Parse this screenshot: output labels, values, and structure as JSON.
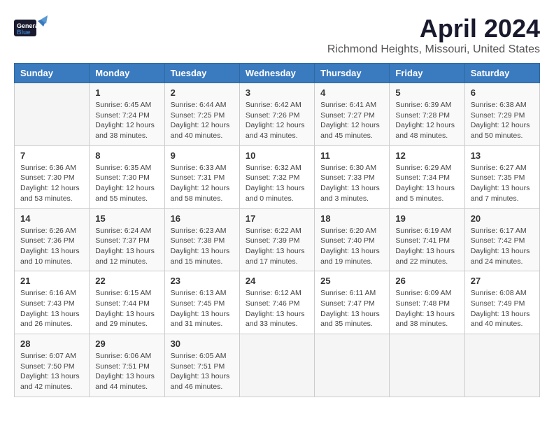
{
  "header": {
    "logo_general": "General",
    "logo_blue": "Blue",
    "month": "April 2024",
    "location": "Richmond Heights, Missouri, United States"
  },
  "days_of_week": [
    "Sunday",
    "Monday",
    "Tuesday",
    "Wednesday",
    "Thursday",
    "Friday",
    "Saturday"
  ],
  "weeks": [
    [
      {
        "day": "",
        "sunrise": "",
        "sunset": "",
        "daylight": ""
      },
      {
        "day": "1",
        "sunrise": "Sunrise: 6:45 AM",
        "sunset": "Sunset: 7:24 PM",
        "daylight": "Daylight: 12 hours and 38 minutes."
      },
      {
        "day": "2",
        "sunrise": "Sunrise: 6:44 AM",
        "sunset": "Sunset: 7:25 PM",
        "daylight": "Daylight: 12 hours and 40 minutes."
      },
      {
        "day": "3",
        "sunrise": "Sunrise: 6:42 AM",
        "sunset": "Sunset: 7:26 PM",
        "daylight": "Daylight: 12 hours and 43 minutes."
      },
      {
        "day": "4",
        "sunrise": "Sunrise: 6:41 AM",
        "sunset": "Sunset: 7:27 PM",
        "daylight": "Daylight: 12 hours and 45 minutes."
      },
      {
        "day": "5",
        "sunrise": "Sunrise: 6:39 AM",
        "sunset": "Sunset: 7:28 PM",
        "daylight": "Daylight: 12 hours and 48 minutes."
      },
      {
        "day": "6",
        "sunrise": "Sunrise: 6:38 AM",
        "sunset": "Sunset: 7:29 PM",
        "daylight": "Daylight: 12 hours and 50 minutes."
      }
    ],
    [
      {
        "day": "7",
        "sunrise": "Sunrise: 6:36 AM",
        "sunset": "Sunset: 7:30 PM",
        "daylight": "Daylight: 12 hours and 53 minutes."
      },
      {
        "day": "8",
        "sunrise": "Sunrise: 6:35 AM",
        "sunset": "Sunset: 7:30 PM",
        "daylight": "Daylight: 12 hours and 55 minutes."
      },
      {
        "day": "9",
        "sunrise": "Sunrise: 6:33 AM",
        "sunset": "Sunset: 7:31 PM",
        "daylight": "Daylight: 12 hours and 58 minutes."
      },
      {
        "day": "10",
        "sunrise": "Sunrise: 6:32 AM",
        "sunset": "Sunset: 7:32 PM",
        "daylight": "Daylight: 13 hours and 0 minutes."
      },
      {
        "day": "11",
        "sunrise": "Sunrise: 6:30 AM",
        "sunset": "Sunset: 7:33 PM",
        "daylight": "Daylight: 13 hours and 3 minutes."
      },
      {
        "day": "12",
        "sunrise": "Sunrise: 6:29 AM",
        "sunset": "Sunset: 7:34 PM",
        "daylight": "Daylight: 13 hours and 5 minutes."
      },
      {
        "day": "13",
        "sunrise": "Sunrise: 6:27 AM",
        "sunset": "Sunset: 7:35 PM",
        "daylight": "Daylight: 13 hours and 7 minutes."
      }
    ],
    [
      {
        "day": "14",
        "sunrise": "Sunrise: 6:26 AM",
        "sunset": "Sunset: 7:36 PM",
        "daylight": "Daylight: 13 hours and 10 minutes."
      },
      {
        "day": "15",
        "sunrise": "Sunrise: 6:24 AM",
        "sunset": "Sunset: 7:37 PM",
        "daylight": "Daylight: 13 hours and 12 minutes."
      },
      {
        "day": "16",
        "sunrise": "Sunrise: 6:23 AM",
        "sunset": "Sunset: 7:38 PM",
        "daylight": "Daylight: 13 hours and 15 minutes."
      },
      {
        "day": "17",
        "sunrise": "Sunrise: 6:22 AM",
        "sunset": "Sunset: 7:39 PM",
        "daylight": "Daylight: 13 hours and 17 minutes."
      },
      {
        "day": "18",
        "sunrise": "Sunrise: 6:20 AM",
        "sunset": "Sunset: 7:40 PM",
        "daylight": "Daylight: 13 hours and 19 minutes."
      },
      {
        "day": "19",
        "sunrise": "Sunrise: 6:19 AM",
        "sunset": "Sunset: 7:41 PM",
        "daylight": "Daylight: 13 hours and 22 minutes."
      },
      {
        "day": "20",
        "sunrise": "Sunrise: 6:17 AM",
        "sunset": "Sunset: 7:42 PM",
        "daylight": "Daylight: 13 hours and 24 minutes."
      }
    ],
    [
      {
        "day": "21",
        "sunrise": "Sunrise: 6:16 AM",
        "sunset": "Sunset: 7:43 PM",
        "daylight": "Daylight: 13 hours and 26 minutes."
      },
      {
        "day": "22",
        "sunrise": "Sunrise: 6:15 AM",
        "sunset": "Sunset: 7:44 PM",
        "daylight": "Daylight: 13 hours and 29 minutes."
      },
      {
        "day": "23",
        "sunrise": "Sunrise: 6:13 AM",
        "sunset": "Sunset: 7:45 PM",
        "daylight": "Daylight: 13 hours and 31 minutes."
      },
      {
        "day": "24",
        "sunrise": "Sunrise: 6:12 AM",
        "sunset": "Sunset: 7:46 PM",
        "daylight": "Daylight: 13 hours and 33 minutes."
      },
      {
        "day": "25",
        "sunrise": "Sunrise: 6:11 AM",
        "sunset": "Sunset: 7:47 PM",
        "daylight": "Daylight: 13 hours and 35 minutes."
      },
      {
        "day": "26",
        "sunrise": "Sunrise: 6:09 AM",
        "sunset": "Sunset: 7:48 PM",
        "daylight": "Daylight: 13 hours and 38 minutes."
      },
      {
        "day": "27",
        "sunrise": "Sunrise: 6:08 AM",
        "sunset": "Sunset: 7:49 PM",
        "daylight": "Daylight: 13 hours and 40 minutes."
      }
    ],
    [
      {
        "day": "28",
        "sunrise": "Sunrise: 6:07 AM",
        "sunset": "Sunset: 7:50 PM",
        "daylight": "Daylight: 13 hours and 42 minutes."
      },
      {
        "day": "29",
        "sunrise": "Sunrise: 6:06 AM",
        "sunset": "Sunset: 7:51 PM",
        "daylight": "Daylight: 13 hours and 44 minutes."
      },
      {
        "day": "30",
        "sunrise": "Sunrise: 6:05 AM",
        "sunset": "Sunset: 7:51 PM",
        "daylight": "Daylight: 13 hours and 46 minutes."
      },
      {
        "day": "",
        "sunrise": "",
        "sunset": "",
        "daylight": ""
      },
      {
        "day": "",
        "sunrise": "",
        "sunset": "",
        "daylight": ""
      },
      {
        "day": "",
        "sunrise": "",
        "sunset": "",
        "daylight": ""
      },
      {
        "day": "",
        "sunrise": "",
        "sunset": "",
        "daylight": ""
      }
    ]
  ]
}
